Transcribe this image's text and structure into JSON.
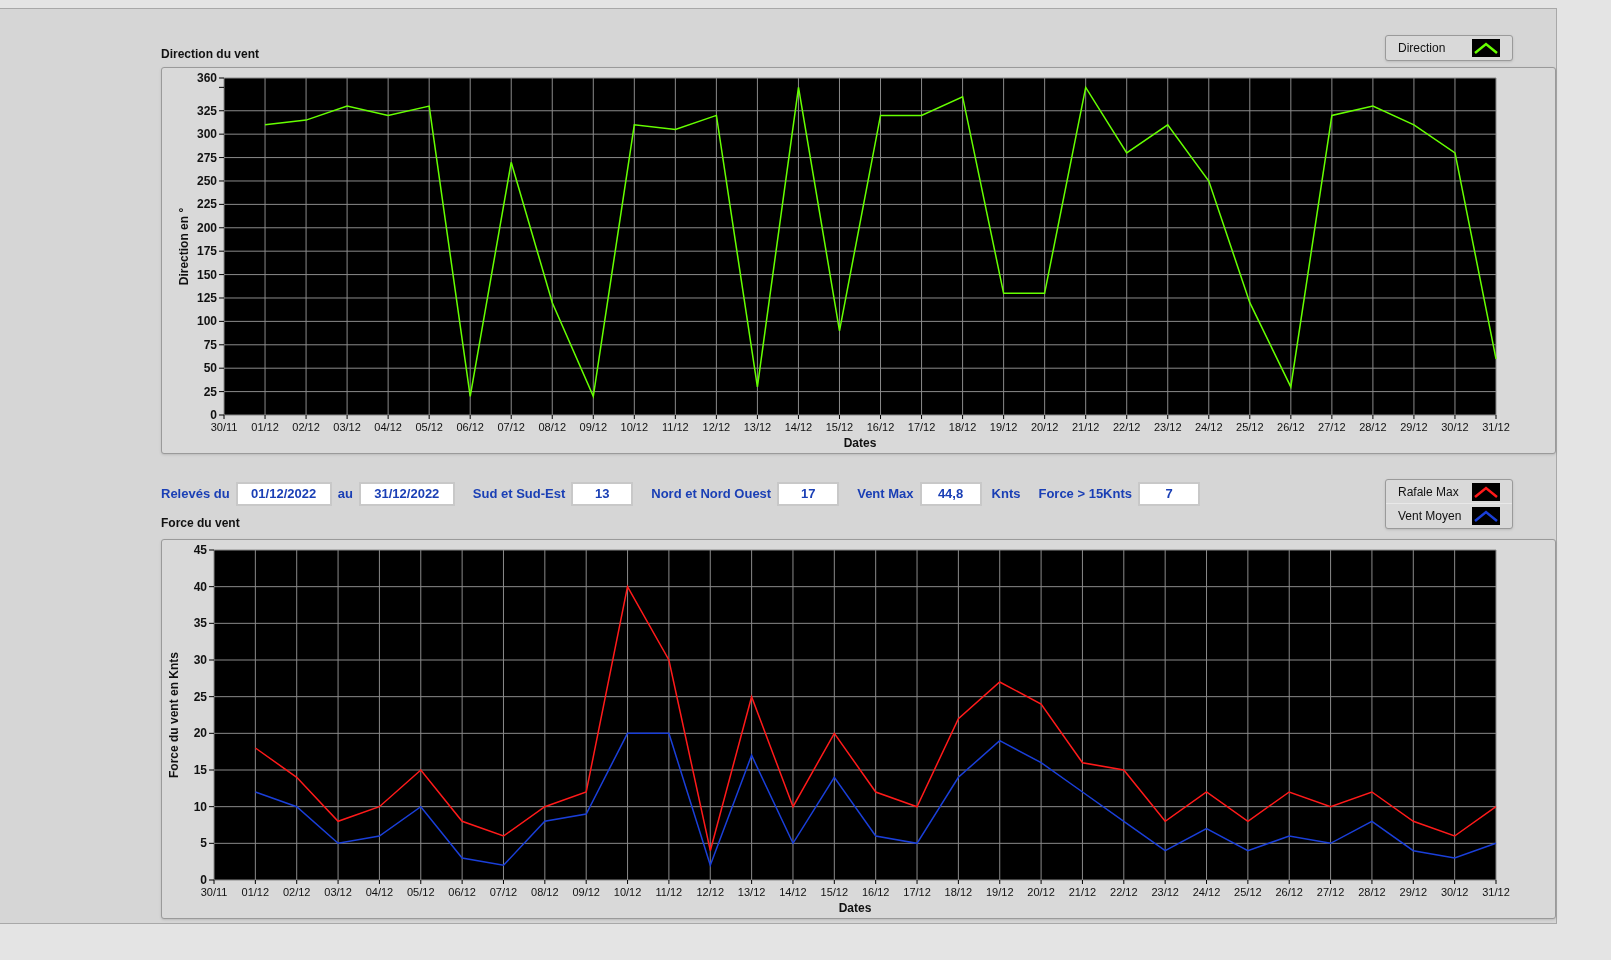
{
  "direction_chart": {
    "title": "Direction du vent",
    "chart_data": {
      "type": "line",
      "grid": true,
      "xlabel": "Dates",
      "ylabel": "Direction en °",
      "x": [
        "30/11",
        "01/12",
        "02/12",
        "03/12",
        "04/12",
        "05/12",
        "06/12",
        "07/12",
        "08/12",
        "09/12",
        "10/12",
        "11/12",
        "12/12",
        "13/12",
        "14/12",
        "15/12",
        "16/12",
        "17/12",
        "18/12",
        "19/12",
        "20/12",
        "21/12",
        "22/12",
        "23/12",
        "24/12",
        "25/12",
        "26/12",
        "27/12",
        "28/12",
        "29/12",
        "30/12",
        "31/12"
      ],
      "ylim": [
        0,
        360
      ],
      "yticks": [
        0,
        25,
        50,
        75,
        100,
        125,
        150,
        175,
        200,
        225,
        250,
        275,
        300,
        325,
        360
      ],
      "series": [
        {
          "name": "Direction",
          "color": "#66ff00",
          "values": [
            null,
            310,
            315,
            330,
            320,
            330,
            20,
            270,
            120,
            20,
            310,
            305,
            320,
            30,
            350,
            90,
            320,
            320,
            340,
            130,
            130,
            350,
            280,
            310,
            250,
            120,
            30,
            320,
            330,
            310,
            280,
            60
          ]
        }
      ]
    }
  },
  "readings": [
    {
      "label": "Relevés du",
      "value": "01/12/2022"
    },
    {
      "label": "au",
      "value": "31/12/2022"
    },
    {
      "label": "Sud et Sud-Est",
      "value": "13"
    },
    {
      "label": "Nord et Nord Ouest",
      "value": "17"
    },
    {
      "label": "Vent Max",
      "value": "44,8",
      "unit": "Knts"
    },
    {
      "label": "Force > 15Knts",
      "value": "7"
    }
  ],
  "force_chart": {
    "title": "Force du vent",
    "chart_data": {
      "type": "line",
      "grid": true,
      "xlabel": "Dates",
      "ylabel": "Force du vent en Knts",
      "x": [
        "30/11",
        "01/12",
        "02/12",
        "03/12",
        "04/12",
        "05/12",
        "06/12",
        "07/12",
        "08/12",
        "09/12",
        "10/12",
        "11/12",
        "12/12",
        "13/12",
        "14/12",
        "15/12",
        "16/12",
        "17/12",
        "18/12",
        "19/12",
        "20/12",
        "21/12",
        "22/12",
        "23/12",
        "24/12",
        "25/12",
        "26/12",
        "27/12",
        "28/12",
        "29/12",
        "30/12",
        "31/12"
      ],
      "ylim": [
        0,
        45
      ],
      "yticks": [
        0,
        5,
        10,
        15,
        20,
        25,
        30,
        35,
        40,
        45
      ],
      "series": [
        {
          "name": "Rafale Max",
          "color": "#ff1a1a",
          "values": [
            null,
            18,
            14,
            8,
            10,
            15,
            8,
            6,
            10,
            12,
            40,
            30,
            4,
            25,
            10,
            20,
            12,
            10,
            22,
            27,
            24,
            16,
            15,
            8,
            12,
            8,
            12,
            10,
            12,
            8,
            6,
            10
          ]
        },
        {
          "name": "Vent Moyen",
          "color": "#1a3fd9",
          "values": [
            null,
            12,
            10,
            5,
            6,
            10,
            3,
            2,
            8,
            9,
            20,
            20,
            2,
            17,
            5,
            14,
            6,
            5,
            14,
            19,
            16,
            12,
            8,
            4,
            7,
            4,
            6,
            5,
            8,
            4,
            3,
            5
          ]
        }
      ]
    }
  }
}
